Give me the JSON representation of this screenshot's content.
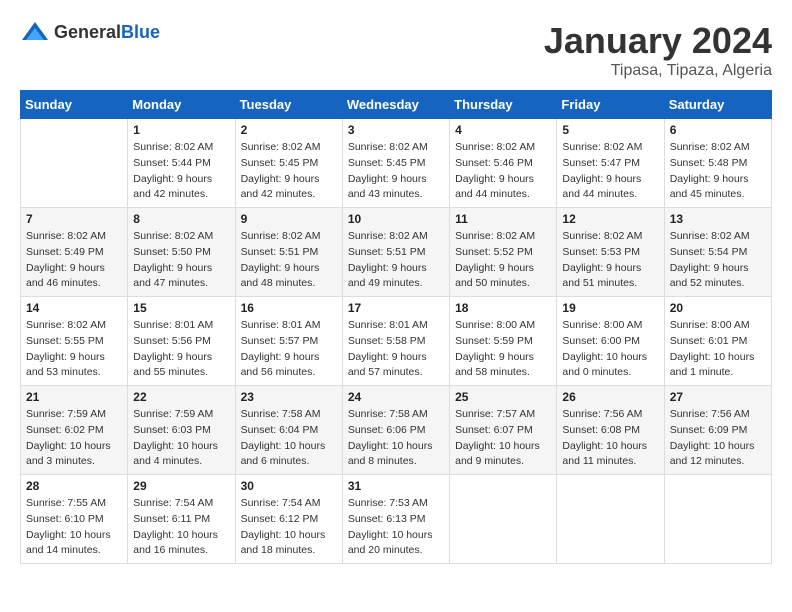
{
  "logo": {
    "general": "General",
    "blue": "Blue"
  },
  "header": {
    "month": "January 2024",
    "location": "Tipasa, Tipaza, Algeria"
  },
  "weekdays": [
    "Sunday",
    "Monday",
    "Tuesday",
    "Wednesday",
    "Thursday",
    "Friday",
    "Saturday"
  ],
  "weeks": [
    [
      {
        "day": "",
        "info": ""
      },
      {
        "day": "1",
        "info": "Sunrise: 8:02 AM\nSunset: 5:44 PM\nDaylight: 9 hours\nand 42 minutes."
      },
      {
        "day": "2",
        "info": "Sunrise: 8:02 AM\nSunset: 5:45 PM\nDaylight: 9 hours\nand 42 minutes."
      },
      {
        "day": "3",
        "info": "Sunrise: 8:02 AM\nSunset: 5:45 PM\nDaylight: 9 hours\nand 43 minutes."
      },
      {
        "day": "4",
        "info": "Sunrise: 8:02 AM\nSunset: 5:46 PM\nDaylight: 9 hours\nand 44 minutes."
      },
      {
        "day": "5",
        "info": "Sunrise: 8:02 AM\nSunset: 5:47 PM\nDaylight: 9 hours\nand 44 minutes."
      },
      {
        "day": "6",
        "info": "Sunrise: 8:02 AM\nSunset: 5:48 PM\nDaylight: 9 hours\nand 45 minutes."
      }
    ],
    [
      {
        "day": "7",
        "info": "Sunrise: 8:02 AM\nSunset: 5:49 PM\nDaylight: 9 hours\nand 46 minutes."
      },
      {
        "day": "8",
        "info": "Sunrise: 8:02 AM\nSunset: 5:50 PM\nDaylight: 9 hours\nand 47 minutes."
      },
      {
        "day": "9",
        "info": "Sunrise: 8:02 AM\nSunset: 5:51 PM\nDaylight: 9 hours\nand 48 minutes."
      },
      {
        "day": "10",
        "info": "Sunrise: 8:02 AM\nSunset: 5:51 PM\nDaylight: 9 hours\nand 49 minutes."
      },
      {
        "day": "11",
        "info": "Sunrise: 8:02 AM\nSunset: 5:52 PM\nDaylight: 9 hours\nand 50 minutes."
      },
      {
        "day": "12",
        "info": "Sunrise: 8:02 AM\nSunset: 5:53 PM\nDaylight: 9 hours\nand 51 minutes."
      },
      {
        "day": "13",
        "info": "Sunrise: 8:02 AM\nSunset: 5:54 PM\nDaylight: 9 hours\nand 52 minutes."
      }
    ],
    [
      {
        "day": "14",
        "info": "Sunrise: 8:02 AM\nSunset: 5:55 PM\nDaylight: 9 hours\nand 53 minutes."
      },
      {
        "day": "15",
        "info": "Sunrise: 8:01 AM\nSunset: 5:56 PM\nDaylight: 9 hours\nand 55 minutes."
      },
      {
        "day": "16",
        "info": "Sunrise: 8:01 AM\nSunset: 5:57 PM\nDaylight: 9 hours\nand 56 minutes."
      },
      {
        "day": "17",
        "info": "Sunrise: 8:01 AM\nSunset: 5:58 PM\nDaylight: 9 hours\nand 57 minutes."
      },
      {
        "day": "18",
        "info": "Sunrise: 8:00 AM\nSunset: 5:59 PM\nDaylight: 9 hours\nand 58 minutes."
      },
      {
        "day": "19",
        "info": "Sunrise: 8:00 AM\nSunset: 6:00 PM\nDaylight: 10 hours\nand 0 minutes."
      },
      {
        "day": "20",
        "info": "Sunrise: 8:00 AM\nSunset: 6:01 PM\nDaylight: 10 hours\nand 1 minute."
      }
    ],
    [
      {
        "day": "21",
        "info": "Sunrise: 7:59 AM\nSunset: 6:02 PM\nDaylight: 10 hours\nand 3 minutes."
      },
      {
        "day": "22",
        "info": "Sunrise: 7:59 AM\nSunset: 6:03 PM\nDaylight: 10 hours\nand 4 minutes."
      },
      {
        "day": "23",
        "info": "Sunrise: 7:58 AM\nSunset: 6:04 PM\nDaylight: 10 hours\nand 6 minutes."
      },
      {
        "day": "24",
        "info": "Sunrise: 7:58 AM\nSunset: 6:06 PM\nDaylight: 10 hours\nand 8 minutes."
      },
      {
        "day": "25",
        "info": "Sunrise: 7:57 AM\nSunset: 6:07 PM\nDaylight: 10 hours\nand 9 minutes."
      },
      {
        "day": "26",
        "info": "Sunrise: 7:56 AM\nSunset: 6:08 PM\nDaylight: 10 hours\nand 11 minutes."
      },
      {
        "day": "27",
        "info": "Sunrise: 7:56 AM\nSunset: 6:09 PM\nDaylight: 10 hours\nand 12 minutes."
      }
    ],
    [
      {
        "day": "28",
        "info": "Sunrise: 7:55 AM\nSunset: 6:10 PM\nDaylight: 10 hours\nand 14 minutes."
      },
      {
        "day": "29",
        "info": "Sunrise: 7:54 AM\nSunset: 6:11 PM\nDaylight: 10 hours\nand 16 minutes."
      },
      {
        "day": "30",
        "info": "Sunrise: 7:54 AM\nSunset: 6:12 PM\nDaylight: 10 hours\nand 18 minutes."
      },
      {
        "day": "31",
        "info": "Sunrise: 7:53 AM\nSunset: 6:13 PM\nDaylight: 10 hours\nand 20 minutes."
      },
      {
        "day": "",
        "info": ""
      },
      {
        "day": "",
        "info": ""
      },
      {
        "day": "",
        "info": ""
      }
    ]
  ]
}
